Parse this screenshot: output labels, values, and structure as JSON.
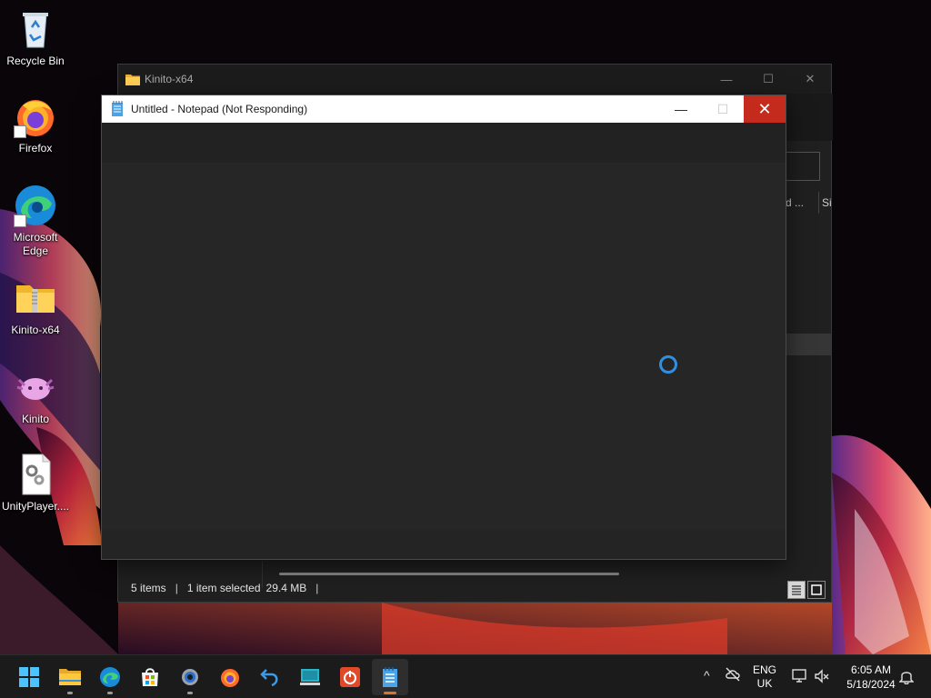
{
  "desktop": {
    "icons": [
      {
        "label": "Recycle Bin",
        "icon": "recycle-bin-icon"
      },
      {
        "label": "Firefox",
        "icon": "firefox-icon"
      },
      {
        "label": "Microsoft Edge",
        "icon": "edge-icon"
      },
      {
        "label": "Kinito-x64",
        "icon": "zip-folder-icon"
      },
      {
        "label": "Kinito",
        "icon": "kinito-axolotl-icon"
      },
      {
        "label": "UnityPlayer....",
        "icon": "dll-file-icon"
      }
    ]
  },
  "explorer": {
    "title": "Kinito-x64",
    "minimize_glyph": "—",
    "maximize_glyph": "☐",
    "close_glyph": "✕",
    "col_headers": [
      "rd ...",
      "Si"
    ],
    "status": {
      "items": "5 items",
      "sep": "|",
      "selected": "1 item selected",
      "size": "29.4 MB"
    }
  },
  "notepad": {
    "title": "Untitled - Notepad (Not Responding)",
    "minimize_glyph": "—",
    "maximize_glyph": "☐",
    "close_glyph": "✕",
    "accent": "#c42b1c",
    "spinner_color": "#2f8fe0"
  },
  "taskbar": {
    "apps": [
      {
        "name": "start",
        "icon": "windows-start-icon"
      },
      {
        "name": "file-explorer",
        "icon": "folder-icon",
        "running": true
      },
      {
        "name": "edge",
        "icon": "edge-icon",
        "running": true
      },
      {
        "name": "store",
        "icon": "store-icon"
      },
      {
        "name": "settings",
        "icon": "gear-icon",
        "running": true
      },
      {
        "name": "firefox",
        "icon": "firefox-icon"
      },
      {
        "name": "undo-app",
        "icon": "undo-arrow-icon"
      },
      {
        "name": "monitor-app",
        "icon": "monitor-icon"
      },
      {
        "name": "power-app",
        "icon": "power-icon"
      },
      {
        "name": "notepad",
        "icon": "notepad-icon",
        "running": true,
        "active": true
      }
    ],
    "tray": {
      "chevron": "^",
      "lang_line1": "ENG",
      "lang_line2": "UK",
      "time": "6:05 AM",
      "date": "5/18/2024"
    }
  }
}
